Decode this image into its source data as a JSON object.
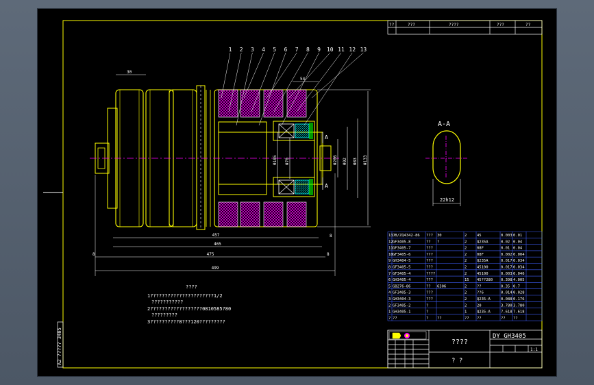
{
  "drawing": {
    "title": "????",
    "drawing_number": "DY GH3405",
    "subtitle": "? ?",
    "scale_label": "1:1",
    "left_margin_text": "A2 ????? 3405"
  },
  "top_title_block": [
    "??",
    "???",
    "????",
    "???",
    "??"
  ],
  "balloons": [
    "1",
    "2",
    "3",
    "4",
    "5",
    "6",
    "7",
    "8",
    "9",
    "10",
    "11",
    "12",
    "13"
  ],
  "section": {
    "label": "A-A",
    "width_dim": "22h12"
  },
  "cut_marks": {
    "upper": "A",
    "lower": "A"
  },
  "dimensions": {
    "top": "30",
    "bore_top": "54",
    "bottom": [
      "457",
      "465",
      "475",
      "499"
    ],
    "side_small": [
      "8",
      "8",
      "8"
    ],
    "vertical": [
      "Φ105",
      "Φ70",
      "Φ206",
      "Φ92",
      "Φ83",
      "Φ133"
    ]
  },
  "tech_notes": {
    "title": "????",
    "lines": [
      "1??????????????????????1/2",
      "???????????",
      "2??????????????????0810585?80",
      "?????????",
      "3??????????8???120?????????"
    ]
  },
  "bom": [
    [
      "13",
      "JB/ZQ4342-86",
      "???",
      "30",
      "2",
      "45",
      "0.003",
      "0.01"
    ],
    [
      "12",
      "GF3405-8",
      "??",
      "?",
      "2",
      "Q235A",
      "0.02",
      "0.04"
    ],
    [
      "11",
      "GF3405-7",
      "???",
      "",
      "2",
      "08F",
      "0.01",
      "0.04"
    ],
    [
      "10",
      "GF3405-6",
      "???",
      "",
      "2",
      "08F",
      "0.002",
      "0.004"
    ],
    [
      "9",
      "GH3404-5",
      "???",
      "",
      "2",
      "Q235A",
      "0.017",
      "0.034"
    ],
    [
      "8",
      "GF3405-5",
      "???",
      "",
      "2",
      "45100",
      "0.017",
      "0.034"
    ],
    [
      "7",
      "GF3405-4",
      "????",
      "",
      "2",
      "45100",
      "0.003",
      "0.046"
    ],
    [
      "6",
      "GH3405-4",
      "???",
      "",
      "15",
      "45??280",
      "0.398",
      "4.005"
    ],
    [
      "5",
      "GB276-86",
      "??",
      "6306",
      "2",
      "??",
      "0.35",
      "0.7"
    ],
    [
      "4",
      "GF3405-3",
      "???",
      "",
      "2",
      "??6",
      "0.014",
      "0.028"
    ],
    [
      "3",
      "GH3404-3",
      "???",
      "",
      "2",
      "Q235-A",
      "0.088",
      "0.176"
    ],
    [
      "2",
      "GF3405-2",
      "?",
      "",
      "2",
      "20",
      "3.780",
      "3.780"
    ],
    [
      "1",
      "GH3405-1",
      "?",
      "",
      "1",
      "Q235-A",
      "7.618",
      "7.618"
    ]
  ],
  "bom_header": [
    "?",
    "??",
    "?",
    "??",
    "??",
    "??",
    "??",
    "??"
  ]
}
